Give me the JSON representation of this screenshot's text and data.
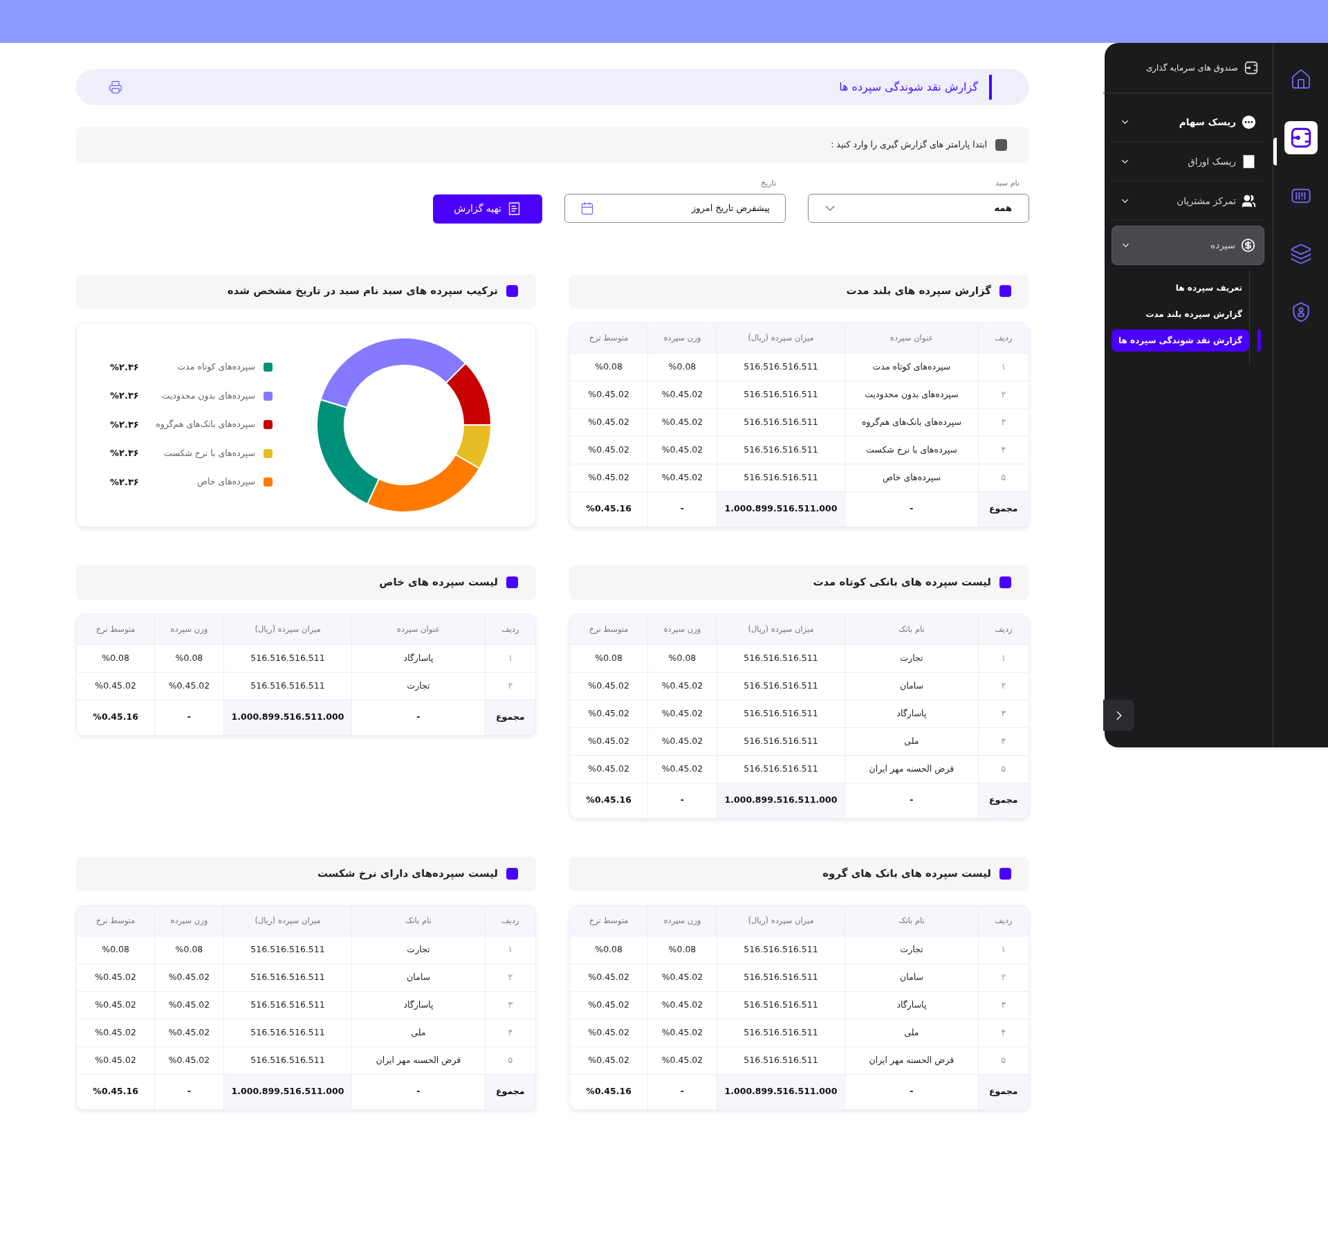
{
  "header": {
    "title": "گزارش نقد شوندگی سپرده ها"
  },
  "params": {
    "note": "ابتدا پارامتر های گزارش گیری را وارد کنید :"
  },
  "form": {
    "basket": {
      "label": "نام سبد",
      "value": "همه"
    },
    "date": {
      "label": "تاریخ",
      "value": "پیشفرض تاریخ امروز"
    },
    "submit": "تهیه گزارش"
  },
  "sections": [
    {
      "kind": "table",
      "title": "گزارش سپرده های بلند مدت",
      "columns": [
        "ردیف",
        "عنوان سپرده",
        "میزان سپرده (ریال)",
        "وزن سپرده",
        "متوسط نرخ"
      ],
      "rows": [
        [
          "۱",
          "سپرده‌های کوتاه مدت",
          "516.516.516.511",
          "%0.08",
          "%0.08"
        ],
        [
          "۲",
          "سپرده‌های بدون محدودیت",
          "516.516.516.511",
          "%0.45.02",
          "%0.45.02"
        ],
        [
          "۳",
          "سپرده‌های بانک‌های هم‌گروه",
          "516.516.516.511",
          "%0.45.02",
          "%0.45.02"
        ],
        [
          "۴",
          "سپرده‌های با نرخ شکست",
          "516.516.516.511",
          "%0.45.02",
          "%0.45.02"
        ],
        [
          "۵",
          "سپرده‌های خاص",
          "516.516.516.511",
          "%0.45.02",
          "%0.45.02"
        ]
      ],
      "total": [
        "مجموع",
        "-",
        "1.000.899.516.511.000",
        "-",
        "%0.45.16"
      ]
    },
    {
      "kind": "donut",
      "title": "ترکیب سپرده های سبد نام سبد در تاریخ مشخص شده",
      "legend": [
        {
          "label": "سپرده‌های کوتاه مدت",
          "value": "%۲.۳۶",
          "color": "#00917a"
        },
        {
          "label": "سپرده‌های بدون محدودیت",
          "value": "%۲.۳۶",
          "color": "#8479ff"
        },
        {
          "label": "سپرده‌های بانک‌های هم‌گروه",
          "value": "%۲.۳۶",
          "color": "#c80000"
        },
        {
          "label": "سپرده‌های با نرخ شکست",
          "value": "%۲.۳۶",
          "color": "#e8bd24"
        },
        {
          "label": "سپرده‌های خاص",
          "value": "%۲.۳۶",
          "color": "#ff7b00"
        }
      ]
    },
    {
      "kind": "table",
      "title": "لیست سپرده های بانکی کوتاه مدت",
      "columns": [
        "ردیف",
        "نام بانک",
        "میزان سپرده (ریال)",
        "وزن سپرده",
        "متوسط نرخ"
      ],
      "rows": [
        [
          "۱",
          "تجارت",
          "516.516.516.511",
          "%0.08",
          "%0.08"
        ],
        [
          "۲",
          "سامان",
          "516.516.516.511",
          "%0.45.02",
          "%0.45.02"
        ],
        [
          "۳",
          "پاسارگاد",
          "516.516.516.511",
          "%0.45.02",
          "%0.45.02"
        ],
        [
          "۴",
          "ملی",
          "516.516.516.511",
          "%0.45.02",
          "%0.45.02"
        ],
        [
          "۵",
          "قرض الحسنه مهر ایران",
          "516.516.516.511",
          "%0.45.02",
          "%0.45.02"
        ]
      ],
      "total": [
        "مجموع",
        "-",
        "1.000.899.516.511.000",
        "-",
        "%0.45.16"
      ]
    },
    {
      "kind": "table",
      "title": "لیست سپرده های خاص",
      "columns": [
        "ردیف",
        "عنوان سپرده",
        "میزان سپرده (ریال)",
        "وزن سپرده",
        "متوسط نرخ"
      ],
      "rows": [
        [
          "۱",
          "پاسارگاد",
          "516.516.516.511",
          "%0.08",
          "%0.08"
        ],
        [
          "۲",
          "تجارت",
          "516.516.516.511",
          "%0.45.02",
          "%0.45.02"
        ]
      ],
      "total": [
        "مجموع",
        "-",
        "1.000.899.516.511.000",
        "-",
        "%0.45.16"
      ]
    },
    {
      "kind": "table",
      "title": "لیست سپرده های بانک های گروه",
      "columns": [
        "ردیف",
        "نام بانک",
        "میزان سپرده (ریال)",
        "وزن سپرده",
        "متوسط نرخ"
      ],
      "rows": [
        [
          "۱",
          "تجارت",
          "516.516.516.511",
          "%0.08",
          "%0.08"
        ],
        [
          "۲",
          "سامان",
          "516.516.516.511",
          "%0.45.02",
          "%0.45.02"
        ],
        [
          "۳",
          "پاسارگاد",
          "516.516.516.511",
          "%0.45.02",
          "%0.45.02"
        ],
        [
          "۴",
          "ملی",
          "516.516.516.511",
          "%0.45.02",
          "%0.45.02"
        ],
        [
          "۵",
          "قرض الحسنه مهر ایران",
          "516.516.516.511",
          "%0.45.02",
          "%0.45.02"
        ]
      ],
      "total": [
        "مجموع",
        "-",
        "1.000.899.516.511.000",
        "-",
        "%0.45.16"
      ]
    },
    {
      "kind": "table",
      "title": "لیست سپرده‌های دارای نرخ شکست",
      "columns": [
        "ردیف",
        "نام بانک",
        "میزان سپرده (ریال)",
        "وزن سپرده",
        "متوسط نرخ"
      ],
      "rows": [
        [
          "۱",
          "تجارت",
          "516.516.516.511",
          "%0.08",
          "%0.08"
        ],
        [
          "۲",
          "سامان",
          "516.516.516.511",
          "%0.45.02",
          "%0.45.02"
        ],
        [
          "۳",
          "پاسارگاد",
          "516.516.516.511",
          "%0.45.02",
          "%0.45.02"
        ],
        [
          "۴",
          "ملی",
          "516.516.516.511",
          "%0.45.02",
          "%0.45.02"
        ],
        [
          "۵",
          "قرض الحسنه مهر ایران",
          "516.516.516.511",
          "%0.45.02",
          "%0.45.02"
        ]
      ],
      "total": [
        "مجموع",
        "-",
        "1.000.899.516.511.000",
        "-",
        "%0.45.16"
      ]
    }
  ],
  "sidebar": {
    "title": "صندوق های سرمایه گذاری",
    "items": [
      {
        "label": "ریسک سهام",
        "active": true,
        "selected": false
      },
      {
        "label": "ریسک اوراق",
        "active": false,
        "selected": false
      },
      {
        "label": "تمرکز مشتریان",
        "active": false,
        "selected": false
      },
      {
        "label": "سپرده",
        "active": false,
        "selected": true,
        "children": [
          {
            "label": "تعریف سپرده ها",
            "selected": false
          },
          {
            "label": "گزارش سپرده بلند مدت",
            "selected": false
          },
          {
            "label": "گزارش نقد شوندگی سپرده ها",
            "selected": true
          }
        ]
      }
    ]
  },
  "rail": [
    {
      "selected": false
    },
    {
      "selected": true
    },
    {
      "selected": false
    },
    {
      "selected": false
    },
    {
      "selected": false
    }
  ]
}
